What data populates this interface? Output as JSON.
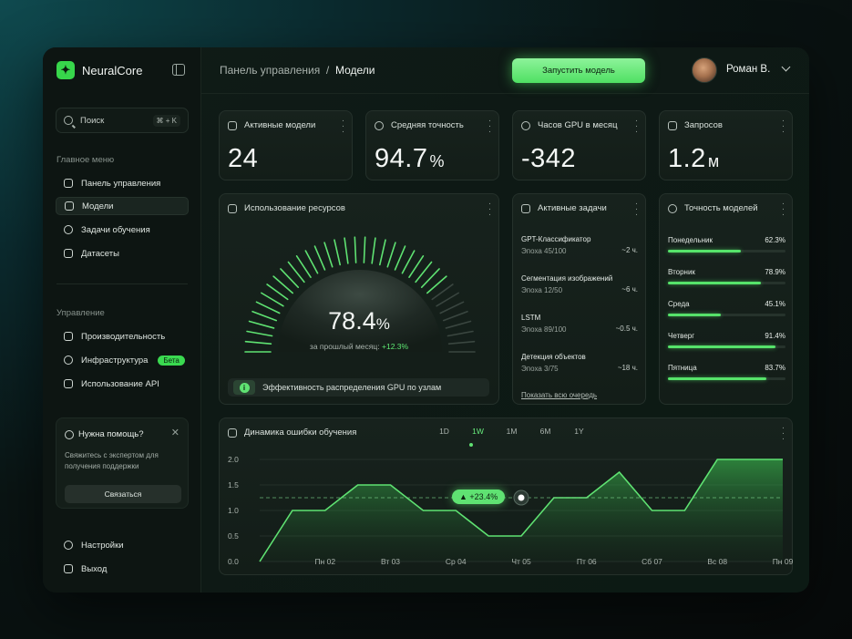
{
  "app": {
    "name": "NeuralCore"
  },
  "search": {
    "placeholder": "Поиск",
    "shortcut": "⌘ + K"
  },
  "sidebar": {
    "main_title": "Главное меню",
    "main_items": [
      {
        "label": "Панель управления",
        "icon": "home-icon"
      },
      {
        "label": "Модели",
        "icon": "model-icon",
        "active": true
      },
      {
        "label": "Задачи обучения",
        "icon": "pie-icon"
      },
      {
        "label": "Датасеты",
        "icon": "copy-icon"
      }
    ],
    "manage_title": "Управление",
    "manage_items": [
      {
        "label": "Производительность",
        "icon": "bolt-icon"
      },
      {
        "label": "Инфраструктура",
        "icon": "cloud-icon",
        "badge": "Бета"
      },
      {
        "label": "Использование API",
        "icon": "inbox-icon"
      }
    ],
    "help": {
      "title": "Нужна помощь?",
      "text": "Свяжитесь с экспертом для получения поддержки",
      "button": "Связаться"
    },
    "bottom_items": [
      {
        "label": "Настройки",
        "icon": "gear-icon"
      },
      {
        "label": "Выход",
        "icon": "logout-icon"
      }
    ]
  },
  "header": {
    "breadcrumb_root": "Панель управления",
    "breadcrumb_sep": "/",
    "breadcrumb_current": "Модели",
    "run_button": "Запустить модель",
    "user_name": "Роман В."
  },
  "stats": [
    {
      "title": "Активные модели",
      "value": "24",
      "unit": ""
    },
    {
      "title": "Средняя точность",
      "value": "94.7",
      "unit": "%"
    },
    {
      "title": "Часов GPU в месяц",
      "value": "-342",
      "unit": ""
    },
    {
      "title": "Запросов",
      "value": "1.2",
      "unit": "м"
    }
  ],
  "resources": {
    "title": "Использование ресурсов",
    "value": "78.4",
    "unit": "%",
    "fraction": 0.784,
    "subtitle": "за прошлый месяц:",
    "delta": "+12.3%",
    "info": "Эффективность распределения GPU по узлам"
  },
  "tasks": {
    "title": "Активные задачи",
    "items": [
      {
        "name": "GPT-Классификатор",
        "epoch": "Эпоха 45/100",
        "time": "~2 ч."
      },
      {
        "name": "Сегментация изображений",
        "epoch": "Эпоха 12/50",
        "time": "~6 ч."
      },
      {
        "name": "LSTM",
        "epoch": "Эпоха 89/100",
        "time": "~0.5 ч."
      },
      {
        "name": "Детекция объектов",
        "epoch": "Эпоха 3/75",
        "time": "~18 ч."
      }
    ],
    "link": "Показать всю очередь"
  },
  "accuracy": {
    "title": "Точность моделей",
    "items": [
      {
        "day": "Понедельник",
        "value": "62.3%",
        "fraction": 0.623
      },
      {
        "day": "Вторник",
        "value": "78.9%",
        "fraction": 0.789
      },
      {
        "day": "Среда",
        "value": "45.1%",
        "fraction": 0.451
      },
      {
        "day": "Четверг",
        "value": "91.4%",
        "fraction": 0.914
      },
      {
        "day": "Пятница",
        "value": "83.7%",
        "fraction": 0.837
      }
    ]
  },
  "loss_chart": {
    "title": "Динамика ошибки обучения",
    "tabs": [
      "1D",
      "1W",
      "1M",
      "6M",
      "1Y"
    ],
    "active_tab": "1W",
    "badge": "+23.4%",
    "colors": {
      "line": "#5fe272",
      "accent": "#37d64b"
    }
  },
  "chart_data": {
    "type": "area",
    "title": "Динамика ошибки обучения",
    "categories": [
      "Пн 02",
      "Вт 03",
      "Ср 04",
      "Чт 05",
      "Пт 06",
      "Сб 07",
      "Вс 08",
      "Пн 09"
    ],
    "x": [
      0,
      0.5,
      1,
      1.5,
      2,
      2.5,
      3,
      3.5,
      4,
      4.5,
      5,
      5.5,
      6,
      6.5,
      7,
      7.5,
      8
    ],
    "values": [
      0.0,
      1.0,
      1.0,
      1.5,
      1.5,
      1.0,
      1.0,
      0.5,
      0.5,
      1.25,
      1.25,
      1.75,
      1.0,
      1.0,
      2.0,
      2.0,
      2.0
    ],
    "yticks": [
      "0.0",
      "0.5",
      "1.0",
      "1.5",
      "2.0"
    ],
    "ylim": [
      0,
      2
    ],
    "reference_value": 1.25,
    "marker_x": 4,
    "grid": true
  }
}
